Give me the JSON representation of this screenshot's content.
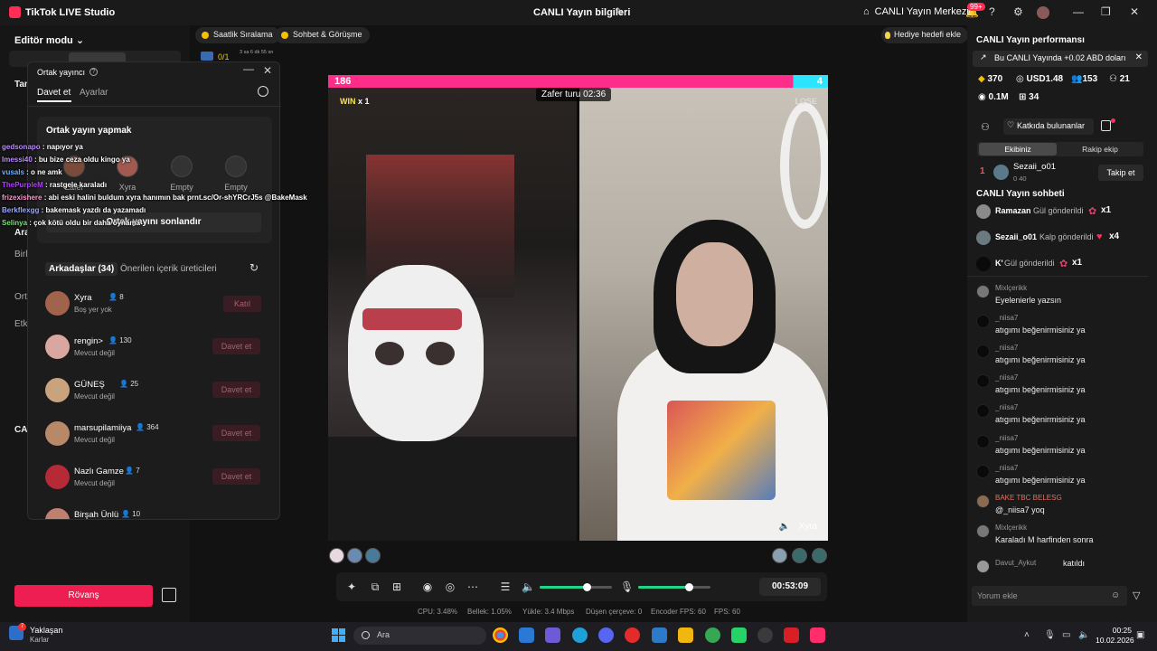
{
  "titlebar": {
    "app_title": "TikTok LIVE Studio",
    "center_title": "CANLI Yayın bilgileri",
    "live_center": "CANLI Yayın Merkezi",
    "notif_badge": "99+"
  },
  "left": {
    "edit_mode": "Editör modu",
    "labels": [
      "Tam",
      "Ara",
      "Birl",
      "Ort",
      "Etki",
      "CA"
    ]
  },
  "chips": {
    "hourly": "Saatlik Sıralama",
    "chat": "Sohbet & Görüşme",
    "goal_count": "0/1",
    "goal_time": "3 sa 6 dk 55 sn"
  },
  "gift_goal": "Hediye hedefi ekle",
  "cohost": {
    "title": "Ortak yayıncı",
    "tab_invite": "Davet et",
    "tab_settings": "Ayarlar",
    "card_title": "Ortak yayın yapmak",
    "slots": [
      {
        "label": "Zafer"
      },
      {
        "label": "Xyra"
      },
      {
        "label": "Empty"
      },
      {
        "label": "Empty"
      }
    ],
    "end_button": "Ortak yayını sonlandır",
    "friends_tab": "Arkadaşlar (34)",
    "suggested_tab": "Önerilen içerik üreticileri",
    "friends": [
      {
        "name": "Xyra",
        "count": "8",
        "status": "Boş yer yok",
        "button": "Katıl",
        "color": "#a0644c"
      },
      {
        "name": "rengin>",
        "count": "130",
        "status": "Mevcut değil",
        "button": "Davet et",
        "color": "#d9a7a0"
      },
      {
        "name": "GÜNEŞ",
        "count": "25",
        "status": "Mevcut değil",
        "button": "Davet et",
        "color": "#c9a27e"
      },
      {
        "name": "marsupilamiiya",
        "count": "364",
        "status": "Mevcut değil",
        "button": "Davet et",
        "color": "#b88868"
      },
      {
        "name": "Nazlı Gamze",
        "count": "7",
        "status": "Mevcut değil",
        "button": "Davet et",
        "color": "#b42a36"
      },
      {
        "name": "Birşah Ünlü",
        "count": "10",
        "status": "",
        "button": "Davet et",
        "color": "#c08070"
      }
    ]
  },
  "overlay_chat": [
    {
      "user": "gedsonapo",
      "text": " : napıyor ya",
      "color": "#b98cff"
    },
    {
      "user": "Imessi40",
      "text": " : bu bize ceza oldu kingo ya",
      "color": "#b98cff"
    },
    {
      "user": "vusals",
      "text": " : o ne amk",
      "color": "#6fb0ff"
    },
    {
      "user": "ThePurpleM",
      "text": " : rastgele karaladı",
      "color": "#b040ff"
    },
    {
      "user": "frizexishere",
      "text": " : abi eski halini buldum xyra hanımın bak prnt.sc/Or-shYRCrJ5s @BakeMask",
      "color": "#ff9ad0"
    },
    {
      "user": "Berkflexgg",
      "text": " : bakemask yazdı da yazamadı",
      "color": "#9aa8ff"
    },
    {
      "user": "Selinya",
      "text": " : çok kötü oldu bir daha oynama",
      "color": "#7fe07f"
    }
  ],
  "rovans": "Rövanş",
  "battle": {
    "score_left": "186",
    "score_right": "4",
    "win_label": "WIN",
    "win_count": "x 1",
    "lose_label": "LOSE",
    "timer": "Zafer turu 02:36",
    "guest_name": "Xyra"
  },
  "controls": {
    "timer": "00:53:09",
    "speaker_volume": 0.65,
    "mic_volume": 0.7
  },
  "stats": {
    "cpu": "CPU: 3.48%",
    "memory": "Bellek: 1.05%",
    "upload": "Yükle: 3.4 Mbps",
    "dropped": "Düşen çerçeve: 0",
    "encoder_fps": "Encoder FPS: 60",
    "fps": "FPS: 60"
  },
  "right": {
    "perf_title": "CANLI Yayın performansı",
    "banner": "Bu CANLI Yayında +0.02 ABD doları",
    "diamonds": "370",
    "usd": "USD1.48",
    "viewers": "153",
    "likes": "21",
    "views": "0.1M",
    "gifters": "34",
    "contributors_btn": "Katkıda bulunanlar",
    "seg_team": "Ekibiniz",
    "seg_rival": "Rakip ekip",
    "rank_num": "1",
    "rank_name": "Sezaii_o01",
    "rank_sub": "0   40",
    "follow_btn": "Takip et",
    "chat_title": "CANLI Yayın sohbeti",
    "gifts": [
      {
        "user": "Ramazan",
        "action": "Gül gönderildi",
        "mult": "x1",
        "icon": "rose"
      },
      {
        "user": "Sezaii_o01",
        "action": "Kalp gönderildi",
        "mult": "x4",
        "icon": "heart"
      },
      {
        "user": "K'",
        "action": "Gül gönderildi",
        "mult": "x1",
        "icon": "rose"
      }
    ],
    "messages": [
      {
        "user": "Mixlçerikk",
        "text": "Eyelenierle yazsın"
      },
      {
        "user": "_niisa7",
        "text": "atıgımı beğenirmisiniz ya"
      },
      {
        "user": "_niisa7",
        "text": "atıgımı beğenirmisiniz ya"
      },
      {
        "user": "_niisa7",
        "text": "atıgımı beğenirmisiniz ya"
      },
      {
        "user": "_niisa7",
        "text": "atıgımı beğenirmisiniz ya"
      },
      {
        "user": "_niisa7",
        "text": "atıgımı beğenirmisiniz ya"
      },
      {
        "user": "_niisa7",
        "text": "atıgımı beğenirmisiniz ya"
      },
      {
        "user": "BAKE TBC BELESG",
        "text": "@_niisa7 yoq"
      },
      {
        "user": "Mixlçerikk",
        "text": "Karaladı M harfinden sonra"
      },
      {
        "user": "Davut_Aykut",
        "text": "katıldı"
      }
    ],
    "comment_placeholder": "Yorum ekle"
  },
  "taskbar": {
    "weather_title": "Yaklaşan",
    "weather_sub": "Karlar",
    "weather_badge": "7",
    "search_placeholder": "Ara",
    "time": "00:25",
    "date": "10.02.2026"
  }
}
